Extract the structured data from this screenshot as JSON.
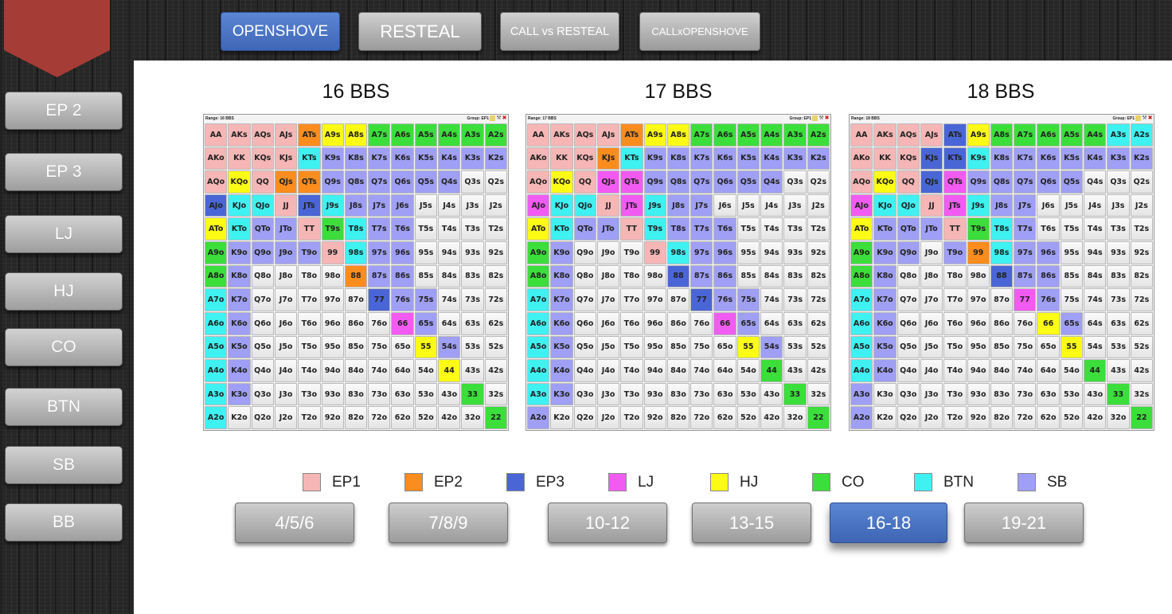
{
  "colors": {
    "EP1": "#f6b6b6",
    "EP2": "#fb8c1e",
    "EP3": "#4a66d6",
    "LJ": "#f25bf2",
    "HJ": "#fbfb16",
    "CO": "#3bde3b",
    "BTN": "#3ff1f1",
    "SB": "#9f9ff5",
    "none": "#f2f2f2"
  },
  "top_tabs": [
    {
      "label": "OPENSHOVE",
      "active": true
    },
    {
      "label": "RESTEAL",
      "active": false
    },
    {
      "label": "CALL vs RESTEAL",
      "active": false
    },
    {
      "label": "CALLxOPENSHOVE",
      "active": false
    }
  ],
  "positions": [
    "EP 2",
    "EP 3",
    "LJ",
    "HJ",
    "CO",
    "BTN",
    "SB",
    "BB"
  ],
  "legend": [
    {
      "label": "EP1",
      "key": "EP1"
    },
    {
      "label": "EP2",
      "key": "EP2"
    },
    {
      "label": "EP3",
      "key": "EP3"
    },
    {
      "label": "LJ",
      "key": "LJ"
    },
    {
      "label": "HJ",
      "key": "HJ"
    },
    {
      "label": "CO",
      "key": "CO"
    },
    {
      "label": "BTN",
      "key": "BTN"
    },
    {
      "label": "SB",
      "key": "SB"
    }
  ],
  "stack_tabs": [
    {
      "label": "4/5/6",
      "active": false
    },
    {
      "label": "7/8/9",
      "active": false
    },
    {
      "label": "10-12",
      "active": false
    },
    {
      "label": "13-15",
      "active": false
    },
    {
      "label": "16-18",
      "active": true
    },
    {
      "label": "19-21",
      "active": false
    }
  ],
  "ranks": [
    "A",
    "K",
    "Q",
    "J",
    "T",
    "9",
    "8",
    "7",
    "6",
    "5",
    "4",
    "3",
    "2"
  ],
  "color_codes": {
    "1": "EP1",
    "2": "EP2",
    "3": "EP3",
    "L": "LJ",
    "H": "HJ",
    "C": "CO",
    "B": "BTN",
    "S": "SB",
    ".": "none"
  },
  "charts": [
    {
      "title": "16 BBS",
      "range_label": "Range: 16 BBS",
      "group_label": "Group: EP1",
      "rows": [
        "11112HHCCCCCC",
        "1111BSSSSSSSS",
        "1H122SSSSSS..",
        "3BB13BSSS....",
        "HBSS1CBSS....",
        "CSSSS1BSS....",
        "CS....2SS....",
        "BS.....3SS...",
        "BS......LS...",
        "BS.......HS..",
        "BS........H..",
        "BS.........C.",
        "B...........C"
      ]
    },
    {
      "title": "17 BBS",
      "range_label": "Range: 17 BBS",
      "group_label": "Group: EP1",
      "rows": [
        "11112HHCCCCCC",
        "1112BSSSSSSSS",
        "1H1LLSSSSSS..",
        "LBB1LBSS.....",
        "HBSS1BSSS....",
        "CS...1BSS....",
        "CS....3SS....",
        "BS.....3SS...",
        "BS......LS...",
        "BS.......HS..",
        "BS........C..",
        "BS.........C.",
        "S...........C"
      ]
    },
    {
      "title": "18 BBS",
      "range_label": "Range: 18 BBS",
      "group_label": "Group: EP1",
      "rows": [
        "11113HCCCCCBB",
        "11133BSSSSSSS",
        "1H13LSSSSS...",
        "LBB1LBSS.....",
        "HSSS1CBS.....",
        "CSS.S2BSS....",
        "CS....3SS....",
        "BS.....LS....",
        "BS......HS...",
        "BS.......H...",
        "BS........C..",
        "S..........C.",
        "S...........C"
      ]
    }
  ]
}
